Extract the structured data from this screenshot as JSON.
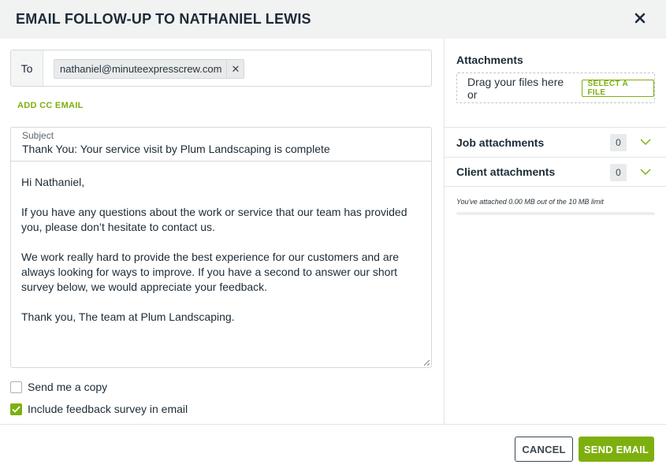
{
  "dialog": {
    "title": "EMAIL FOLLOW-UP TO NATHANIEL LEWIS",
    "close_icon": "close-icon"
  },
  "recipients": {
    "to_label": "To",
    "chips": [
      "nathaniel@minuteexpresscrew.com"
    ],
    "chip_remove_icon": "remove-icon",
    "add_cc_label": "ADD CC EMAIL"
  },
  "message": {
    "subject_label": "Subject",
    "subject_value": "Thank You: Your service visit by Plum Landscaping is complete",
    "body": [
      "Hi Nathaniel,",
      "If you have any questions about the work or service that our team has provided you, please don’t hesitate to contact us.",
      "We work really hard to provide the best experience for our customers and are always looking for ways to improve. If you have a second to answer our short survey below, we would appreciate your feedback.",
      "Thank you, The team at Plum Landscaping."
    ]
  },
  "options": {
    "send_copy": {
      "label": "Send me a copy",
      "checked": false
    },
    "feedback_survey": {
      "label": "Include feedback survey in email",
      "checked": true
    }
  },
  "attachments": {
    "title": "Attachments",
    "dropzone_text": "Drag your files here or",
    "select_file_label": "SELECT A FILE",
    "sections": [
      {
        "label": "Job attachments",
        "count": "0"
      },
      {
        "label": "Client attachments",
        "count": "0"
      }
    ],
    "limit_text": "You've attached 0.00 MB out of the 10 MB limit",
    "used_fraction": 0
  },
  "footer": {
    "cancel_label": "CANCEL",
    "send_label": "SEND EMAIL"
  },
  "colors": {
    "accent": "#7db00e",
    "text": "#1c2b36",
    "header_bg": "#f1f2f2"
  }
}
